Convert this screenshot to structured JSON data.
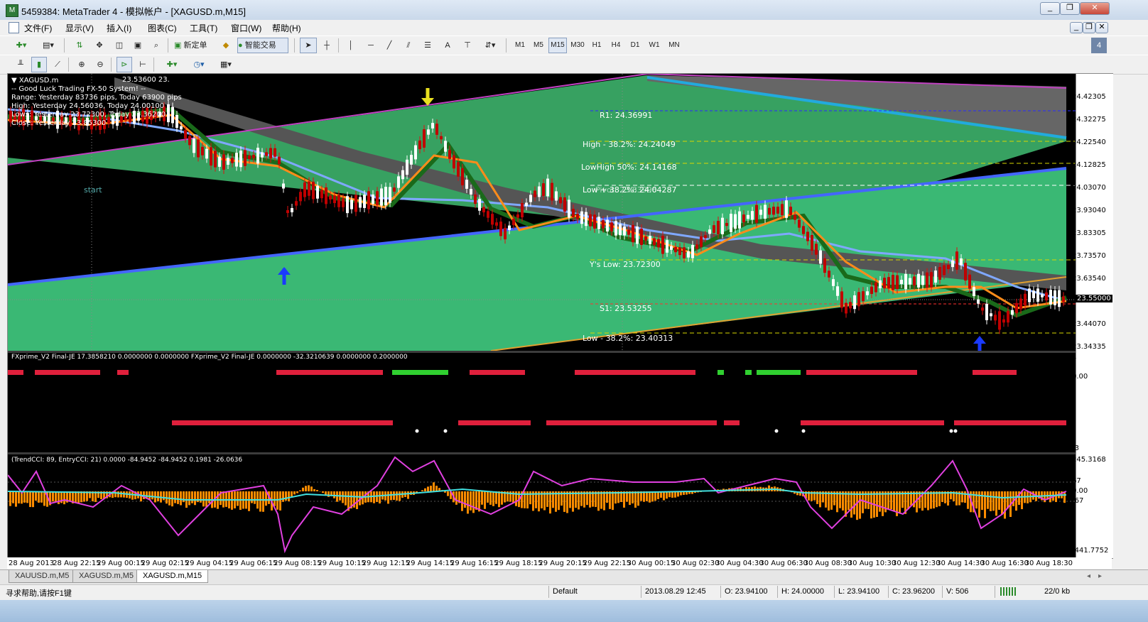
{
  "window": {
    "title": "5459384: MetaTrader 4 - 模拟帐户 - [XAGUSD.m,M15]",
    "minimize": "_",
    "restore": "❐",
    "close": "✕"
  },
  "menu": [
    "文件(F)",
    "显示(V)",
    "插入(I)",
    "图表(C)",
    "工具(T)",
    "窗口(W)",
    "帮助(H)"
  ],
  "toolbar": {
    "new_order": "新定单",
    "auto_trading": "智能交易",
    "timeframes": [
      "M1",
      "M5",
      "M15",
      "M30",
      "H1",
      "H4",
      "D1",
      "W1",
      "MN"
    ],
    "active_timeframe": "M15"
  },
  "chart": {
    "symbol_label": "XAGUSD.m",
    "info_lines": [
      "-- Good Luck Trading FX-50 System! --",
      "Range: Yesterday 83736 pips, Today 63900 pips",
      "High: Yesterday 24.56036, Today 24.00100",
      "Lows: Yesterday 23.72300, Today 23.36200",
      "Close: Yesterday 23.85300"
    ],
    "top_price_fragment": "23.53600 23.",
    "start_label": "start",
    "levels": [
      {
        "label": "R1: 24.36991",
        "color": "#2b2bff"
      },
      {
        "label": "High - 38.2%: 24.24049",
        "color": "#d8d800"
      },
      {
        "label": "LowHigh 50%: 24.14168",
        "color": "#d8d800"
      },
      {
        "label": "Low + 38.2%: 24.04287",
        "color": "#ffffff"
      },
      {
        "label": "Pivot: 23.83996",
        "color": "#ffffff"
      },
      {
        "label": "Y's Low: 23.72300",
        "color": "#d8d800"
      },
      {
        "label": "S1: 23.53255",
        "color": "#ff3030"
      },
      {
        "label": "Low - 38.2%: 23.40313",
        "color": "#d8d800"
      }
    ],
    "price_axis": [
      "24.42305",
      "24.32275",
      "24.22540",
      "24.12825",
      "24.03070",
      "23.93040",
      "23.83305",
      "23.73570",
      "23.63540",
      "23.55000",
      "23.44070",
      "23.34335"
    ],
    "current_price": "23.55000"
  },
  "indicator1": {
    "label": "FXprime_V2 Final-JE 17.3858210 0.0000000 0.0000000   FXprime_V2 Final-JE 0.0000000 -32.3210639 0.0000000 0.2000000",
    "axis": [
      "1",
      "0.00",
      "-3"
    ]
  },
  "indicator2": {
    "label": "(TrendCCI: 89, EntryCCI: 21)  0.0000 -84.9452 -84.9452 0.1981 -26.0636",
    "axis": [
      "245.3168",
      "67",
      "0.00",
      "-67",
      "-441.7752"
    ]
  },
  "time_axis": [
    "28 Aug 2013",
    "28 Aug 22:15",
    "29 Aug 00:15",
    "29 Aug 02:15",
    "29 Aug 04:15",
    "29 Aug 06:15",
    "29 Aug 08:15",
    "29 Aug 10:15",
    "29 Aug 12:15",
    "29 Aug 14:15",
    "29 Aug 16:15",
    "29 Aug 18:15",
    "29 Aug 20:15",
    "29 Aug 22:15",
    "30 Aug 00:15",
    "30 Aug 02:30",
    "30 Aug 04:30",
    "30 Aug 06:30",
    "30 Aug 08:30",
    "30 Aug 10:30",
    "30 Aug 12:30",
    "30 Aug 14:30",
    "30 Aug 16:30",
    "30 Aug 18:30"
  ],
  "tabs": [
    "XAUUSD.m,M5",
    "XAGUSD.m,M5",
    "XAGUSD.m,M15"
  ],
  "active_tab": "XAGUSD.m,M15",
  "status": {
    "help": "寻求帮助,请按F1键",
    "profile": "Default",
    "datetime": "2013.08.29 12:45",
    "open": "O: 23.94100",
    "high": "H: 24.00000",
    "low": "L: 23.94100",
    "close": "C: 23.96200",
    "volume": "V: 506",
    "traffic": "22/0 kb"
  }
}
